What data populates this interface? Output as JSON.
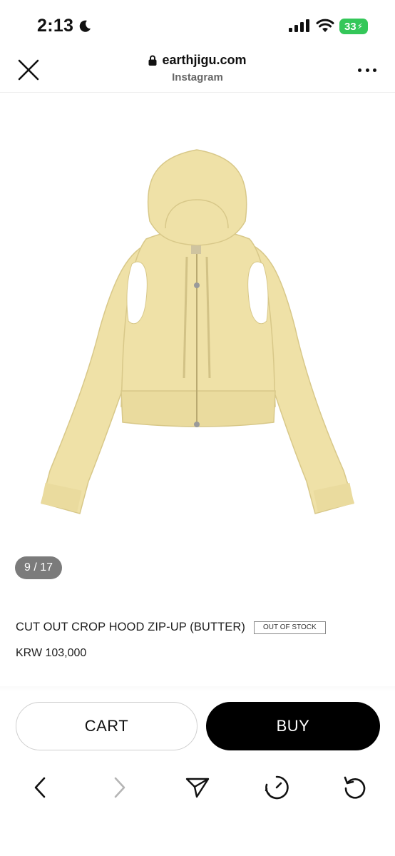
{
  "status_bar": {
    "time": "2:13",
    "battery": "33"
  },
  "browser": {
    "domain": "earthjigu.com",
    "subtitle": "Instagram"
  },
  "gallery": {
    "counter": "9 / 17"
  },
  "product": {
    "title": "CUT OUT CROP HOOD ZIP-UP (BUTTER)",
    "stock_badge": "OUT OF STOCK",
    "price": "KRW 103,000",
    "garment_color": "#efe1a7"
  },
  "actions": {
    "cart_label": "CART",
    "buy_label": "BUY"
  },
  "icons": {
    "close": "close-icon",
    "lock": "lock-icon",
    "more": "more-icon",
    "back": "back-icon",
    "forward": "forward-icon",
    "share": "share-icon",
    "timer": "timer-icon",
    "reload": "reload-icon"
  }
}
